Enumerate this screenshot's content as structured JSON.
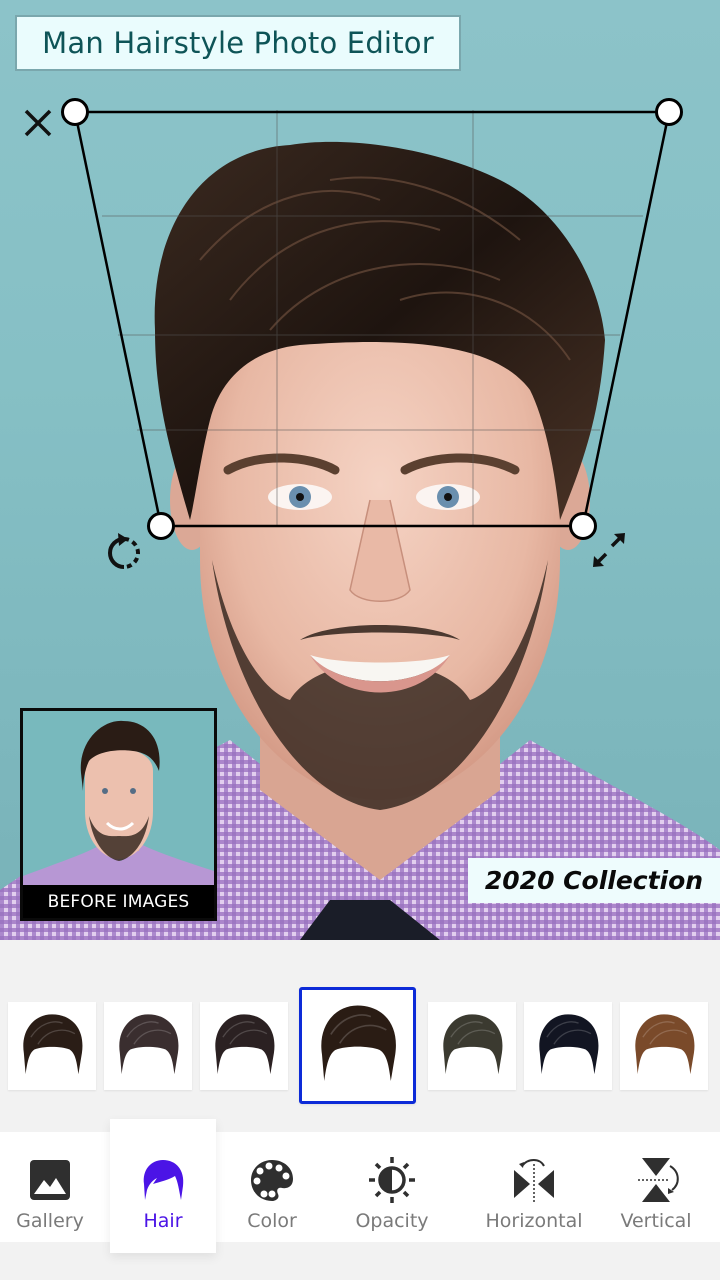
{
  "app": {
    "title": "Man Hairstyle Photo Editor"
  },
  "editor": {
    "close_icon": "close-icon",
    "rotate_icon": "rotate-icon",
    "scale_icon": "resize-diagonal-icon",
    "before_caption": "BEFORE IMAGES",
    "collection_label": "2020 Collection"
  },
  "hair_styles": {
    "selected_index": 3,
    "items": [
      {
        "name": "hairstyle-1",
        "color": "#2a1d16"
      },
      {
        "name": "hairstyle-2",
        "color": "#3a2e2f"
      },
      {
        "name": "hairstyle-3",
        "color": "#2b2122"
      },
      {
        "name": "hairstyle-4",
        "color": "#2a1c14"
      },
      {
        "name": "hairstyle-5",
        "color": "#3b3a30"
      },
      {
        "name": "hairstyle-6",
        "color": "#121522"
      },
      {
        "name": "hairstyle-7",
        "color": "#7a4a2a"
      }
    ]
  },
  "bottom_nav": {
    "active": "Hair",
    "accent_color": "#4b14e6",
    "items": [
      {
        "label": "Gallery",
        "icon": "gallery-icon"
      },
      {
        "label": "Hair",
        "icon": "hair-icon"
      },
      {
        "label": "Color",
        "icon": "palette-icon"
      },
      {
        "label": "Opacity",
        "icon": "opacity-icon"
      },
      {
        "label": "Horizontal",
        "icon": "flip-horizontal-icon"
      },
      {
        "label": "Vertical",
        "icon": "flip-vertical-icon"
      }
    ]
  }
}
